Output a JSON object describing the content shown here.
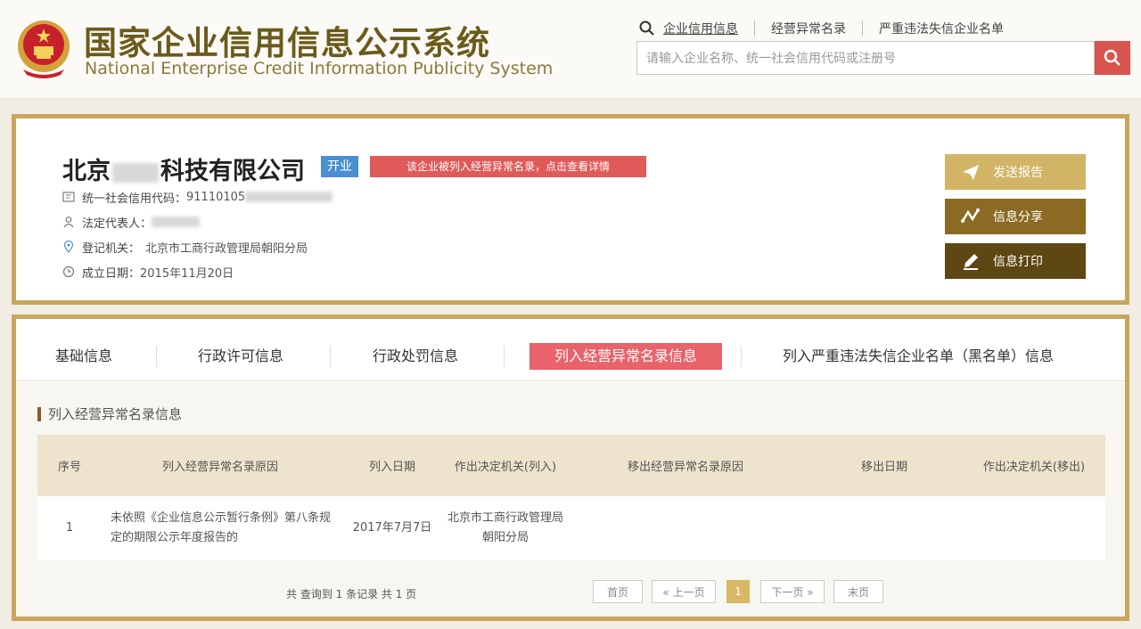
{
  "header": {
    "title_cn": "国家企业信用信息公示系统",
    "title_en": "National Enterprise Credit Information Publicity System",
    "links": [
      "企业信用信息",
      "经营异常名录",
      "严重违法失信企业名单"
    ],
    "search_placeholder": "请输入企业名称、统一社会信用代码或注册号"
  },
  "company": {
    "name_prefix": "北京",
    "name_suffix": "科技有限公司",
    "status": "开业",
    "notice": "该企业被列入经营异常名录，点击查看详情",
    "credit_code_label": "统一社会信用代码：",
    "credit_code": "91110105",
    "legal_rep_label": "法定代表人：",
    "authority_label": "登记机关：",
    "authority": "北京市工商行政管理局朝阳分局",
    "established_label": "成立日期：",
    "established": "2015年11月20日"
  },
  "actions": [
    "发送报告",
    "信息分享",
    "信息打印"
  ],
  "tabs": [
    "基础信息",
    "行政许可信息",
    "行政处罚信息",
    "列入经营异常名录信息",
    "列入严重违法失信企业名单（黑名单）信息"
  ],
  "section_title": "列入经营异常名录信息",
  "table": {
    "headers": [
      "序号",
      "列入经营异常名录原因",
      "列入日期",
      "作出决定机关(列入)",
      "移出经营异常名录原因",
      "移出日期",
      "作出决定机关(移出)"
    ],
    "rows": [
      [
        "1",
        "未依照《企业信息公示暂行条例》第八条规定的期限公示年度报告的",
        "2017年7月7日",
        "北京市工商行政管理局朝阳分局",
        "",
        "",
        ""
      ]
    ]
  },
  "pagination": {
    "info": "共 查询到 1 条记录 共 1 页",
    "first": "首页",
    "prev": "« 上一页",
    "current": "1",
    "next": "下一页 »",
    "last": "末页"
  }
}
